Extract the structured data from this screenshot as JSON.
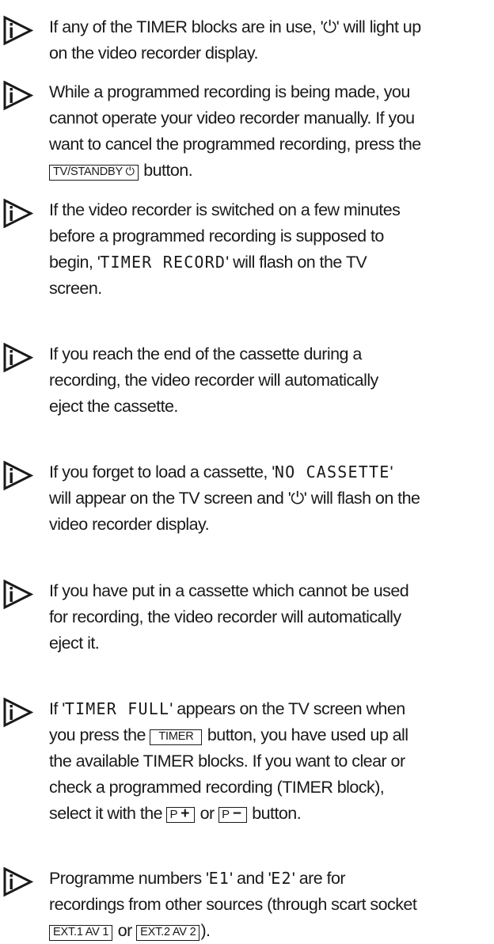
{
  "notes": [
    {
      "lines": [
        [
          {
            "t": "If any of the TIMER blocks are in use, '⏻' will light up"
          }
        ],
        [
          {
            "t": "on the video recorder display."
          }
        ]
      ]
    },
    {
      "lines": [
        [
          {
            "t": "While a programmed recording is being made, you"
          }
        ],
        [
          {
            "t": "cannot operate your video recorder manually. If you"
          }
        ],
        [
          {
            "t": "want to cancel the programmed recording, press the"
          }
        ],
        [
          {
            "k": "TV/STANDBY ⏻"
          },
          {
            "t": " button."
          }
        ]
      ]
    },
    {
      "lines": [
        [
          {
            "t": "If the video recorder is switched on a few minutes"
          }
        ],
        [
          {
            "t": "before a programmed recording is supposed to"
          }
        ],
        [
          {
            "t": "begin, '"
          },
          {
            "m": "TIMER RECORD"
          },
          {
            "t": "' will flash on the TV"
          }
        ],
        [
          {
            "t": "screen."
          }
        ]
      ]
    },
    {
      "lines": [
        [
          {
            "t": "If you reach the end of the cassette during a"
          }
        ],
        [
          {
            "t": "recording, the video recorder will automatically"
          }
        ],
        [
          {
            "t": "eject the cassette."
          }
        ]
      ]
    },
    {
      "lines": [
        [
          {
            "t": "If you forget to load a cassette, '"
          },
          {
            "m": "NO CASSETTE"
          },
          {
            "t": "'"
          }
        ],
        [
          {
            "t": "will appear on the TV screen and '⏻' will flash on the"
          }
        ],
        [
          {
            "t": "video recorder display."
          }
        ]
      ]
    },
    {
      "lines": [
        [
          {
            "t": "If you have put in a cassette which cannot be used"
          }
        ],
        [
          {
            "t": "for recording, the video recorder will automatically"
          }
        ],
        [
          {
            "t": "eject it."
          }
        ]
      ]
    },
    {
      "lines": [
        [
          {
            "t": "If '"
          },
          {
            "m": "TIMER FULL"
          },
          {
            "t": "' appears on the TV screen when"
          }
        ],
        [
          {
            "t": "you press the "
          },
          {
            "kw": "TIMER"
          },
          {
            "t": " button, you have used up all"
          }
        ],
        [
          {
            "t": "the available TIMER blocks. If you want to clear or"
          }
        ],
        [
          {
            "t": "check a programmed recording (TIMER block),"
          }
        ],
        [
          {
            "t": "select it with the "
          },
          {
            "ks": "P",
            "sym": "+"
          },
          {
            "t": " or "
          },
          {
            "ks": "P",
            "sym": "−"
          },
          {
            "t": " button."
          }
        ]
      ]
    },
    {
      "lines": [
        [
          {
            "t": "Programme numbers '"
          },
          {
            "m": "E1"
          },
          {
            "t": "' and '"
          },
          {
            "m": "E2"
          },
          {
            "t": "' are for"
          }
        ],
        [
          {
            "t": "recordings from other sources (through scart socket"
          }
        ],
        [
          {
            "k": "EXT.1 AV 1"
          },
          {
            "t": " or "
          },
          {
            "k": "EXT.2 AV 2"
          },
          {
            "t": ")."
          }
        ]
      ]
    }
  ]
}
